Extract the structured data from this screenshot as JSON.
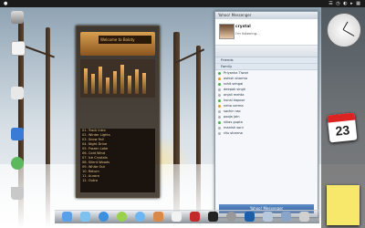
{
  "menubar": {
    "right": "☰ ◷ ◐ ▸ ▦"
  },
  "player": {
    "track_title": "Welcome to Boloty",
    "playlist": [
      "01. Track Intro",
      "02. Winter Lights",
      "03. Snow Fall",
      "04. Night Drive",
      "05. Frozen Lake",
      "06. Cold Wind",
      "07. Ice Crystals",
      "08. Silent Woods",
      "09. White Out",
      "10. Return",
      "11. Aurora",
      "12. Outro"
    ]
  },
  "im": {
    "title": "Yahoo! Messenger",
    "name": "crystal",
    "status": "i'm listening...",
    "groups": [
      {
        "label": "Friends"
      },
      {
        "label": "Family"
      }
    ],
    "contacts": [
      "Priyanka Tiwari",
      "ashish sharma",
      "rohit sehgal",
      "deepak singh",
      "anjali mehta",
      "kunal kapoor",
      "neha verma",
      "sachin rao",
      "pooja jain",
      "vikas gupta",
      "manish soni",
      "ritu sharma"
    ],
    "bottom": "Yahoo! Messenger"
  },
  "widgets": {
    "calendar_day": "23"
  }
}
